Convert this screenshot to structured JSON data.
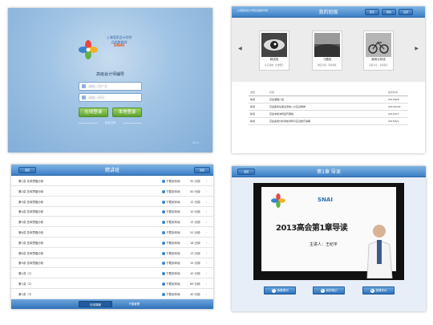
{
  "login": {
    "logo_lines": [
      "上海国家会计学院",
      "远程教育网",
      "SNAI"
    ],
    "subtitle": "高级会计师辅导",
    "username_placeholder": "请输入用户名",
    "password_placeholder": "请输入密码",
    "online_login": "在线登录",
    "local_login": "本地登录",
    "trial": "免费试听",
    "version": "V1.0"
  },
  "my_class": {
    "header_left": "上海国家会计学院远程教育网",
    "title": "我的班级",
    "header_buttons": [
      "首页",
      "留言",
      "设置"
    ],
    "cards": [
      {
        "title": "精讲班",
        "desc": "扎实基础、注重细节"
      },
      {
        "title": "习题班",
        "desc": "精选习题、同步训练"
      },
      {
        "title": "案例分析班",
        "desc": "深析考点、专家指导"
      }
    ],
    "table_headers": [
      "类型",
      "标题",
      "发布时间"
    ],
    "rows": [
      {
        "type": "新闻",
        "title": "高会课程介绍",
        "date": "2013/6/8"
      },
      {
        "type": "新闻",
        "title": "高会备考生需注意的八大应试规律",
        "date": "2013/5/29"
      },
      {
        "type": "新闻",
        "title": "高会考前冲刺班开课啦",
        "date": "2013/4/1"
      },
      {
        "type": "新闻",
        "title": "高会案例分析考前冲刺与应试技巧讲解",
        "date": "2013/4/1"
      }
    ]
  },
  "course_list": {
    "title": "精讲班",
    "back": "返回",
    "right_button": "班级",
    "items": [
      {
        "name": "第1讲 总体思路分析",
        "action": "下载到本地",
        "duration": "30 分钟"
      },
      {
        "name": "第2讲 总体思路分析",
        "action": "下载到本地",
        "duration": "50 分钟"
      },
      {
        "name": "第3讲 总体思路分析",
        "action": "下载到本地",
        "duration": "12 分钟"
      },
      {
        "name": "第4讲 总体思路分析",
        "action": "下载到本地",
        "duration": "10 分钟"
      },
      {
        "name": "第5讲 总体思路分析",
        "action": "下载到本地",
        "duration": "12 分钟"
      },
      {
        "name": "第6讲 总体思路分析",
        "action": "下载到本地",
        "duration": "20 分钟"
      },
      {
        "name": "第7讲 总体思路分析",
        "action": "下载到本地",
        "duration": "18 分钟"
      },
      {
        "name": "第8讲 总体思路分析",
        "action": "下载到本地",
        "duration": "13 分钟"
      },
      {
        "name": "第9讲 总体思路分析",
        "action": "下载到本地",
        "duration": "15 分钟"
      },
      {
        "name": "第1讲（1）",
        "action": "下载到本地",
        "duration": "10 分钟"
      },
      {
        "name": "第1讲（2）",
        "action": "下载到本地",
        "duration": "69 分钟"
      },
      {
        "name": "第1讲（3）",
        "action": "下载到本地",
        "duration": "40 分钟"
      }
    ],
    "tabs": [
      "在线课程",
      "下载管理"
    ]
  },
  "video": {
    "title": "第1章 导读",
    "back": "返回",
    "slide_title": "2013高会第1章导读",
    "speaker": "主讲人：王纪平",
    "slide_logo": "SNAI",
    "buttons": [
      "我要提问",
      "我的笔记",
      "授课评价"
    ]
  }
}
